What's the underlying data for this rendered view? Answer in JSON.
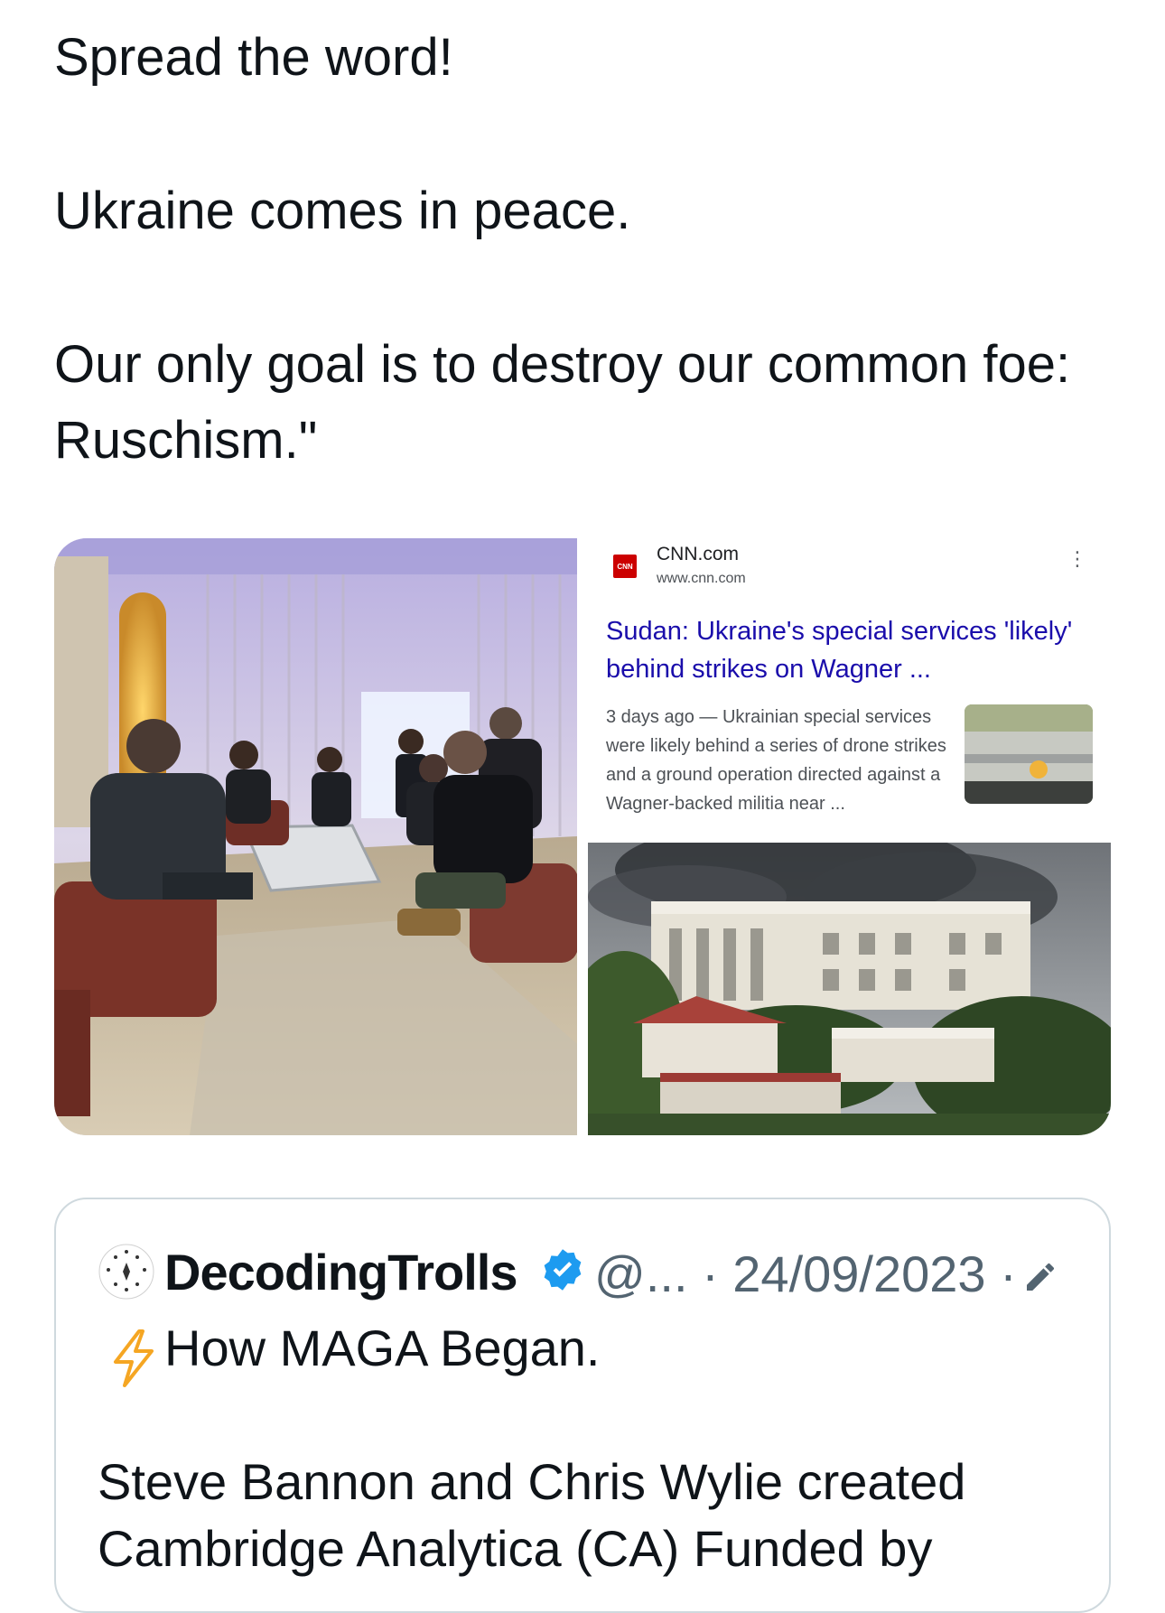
{
  "tweet": {
    "line1": "Spread the word!",
    "line2": "Ukraine comes in peace.",
    "line3": "Our only goal is to destroy our common foe: Ruschism.\""
  },
  "media": {
    "search_result": {
      "logo_text": "CNN",
      "site_name": "CNN.com",
      "site_url": "www.cnn.com",
      "headline": "Sudan: Ukraine's special services 'likely' behind strikes on Wagner ...",
      "snippet": "3 days ago — Ukrainian special services were likely behind a series of drone strikes and a ground operation directed against a Wagner-backed militia near ...",
      "menu_icon": "more-vertical-icon"
    }
  },
  "quote": {
    "author_name": "DecodingTrolls",
    "meta": "@... · 24/09/2023 ·",
    "verified_icon": "verified-badge-icon",
    "edit_icon": "edited-pencil-icon",
    "lead_icon": "lightning-bolt-icon",
    "line1": "How MAGA Began.",
    "body": "Steve Bannon and Chris Wylie created Cambridge Analytica (CA) Funded by"
  },
  "colors": {
    "text": "#0f1419",
    "muted": "#536471",
    "link": "#1a0dab",
    "verified": "#1d9bf0",
    "cnn_red": "#cc0000",
    "bolt": "#f5a623"
  }
}
